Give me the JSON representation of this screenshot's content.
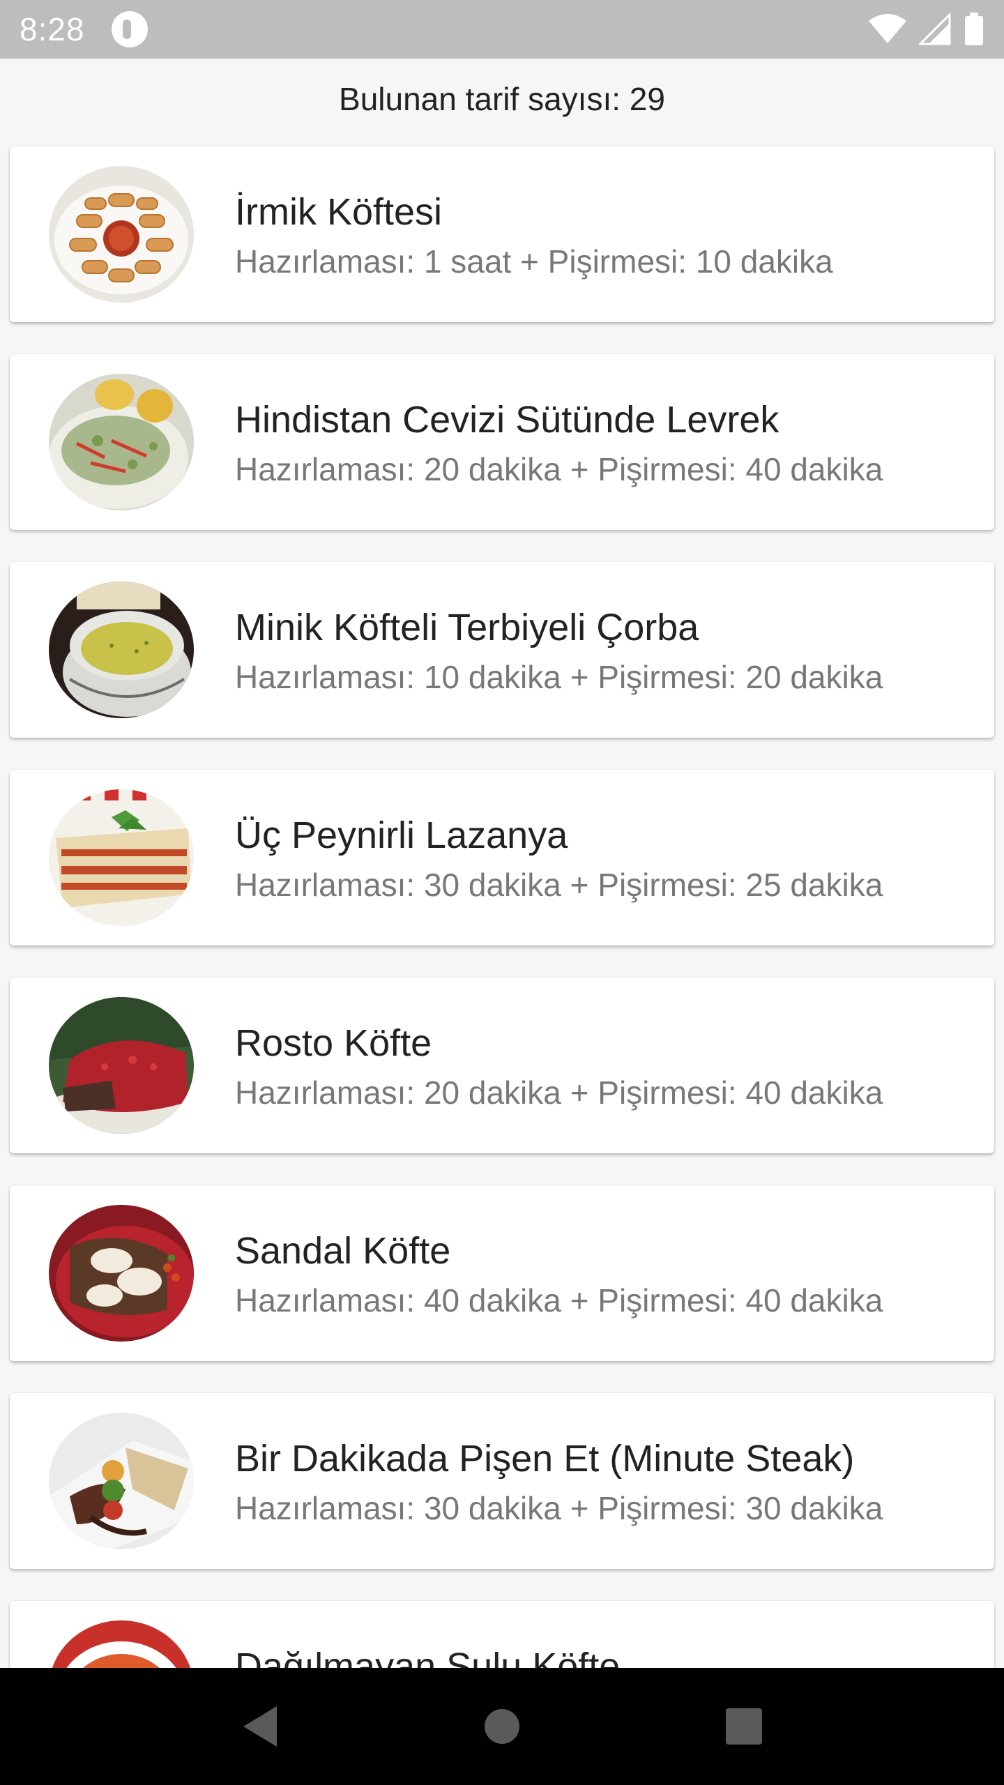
{
  "status_bar": {
    "time": "8:28",
    "icons": [
      "app-notification-icon",
      "wifi-icon",
      "signal-icon",
      "battery-icon"
    ]
  },
  "header": {
    "result_count": "Bulunan tarif sayısı: 29"
  },
  "recipes": [
    {
      "title": "İrmik Köftesi",
      "meta": "Hazırlaması: 1 saat + Pişirmesi: 10 dakika"
    },
    {
      "title": "Hindistan Cevizi Sütünde Levrek",
      "meta": "Hazırlaması: 20 dakika + Pişirmesi: 40 dakika"
    },
    {
      "title": "Minik Köfteli Terbiyeli Çorba",
      "meta": "Hazırlaması: 10 dakika + Pişirmesi: 20 dakika"
    },
    {
      "title": "Üç Peynirli Lazanya",
      "meta": "Hazırlaması: 30 dakika + Pişirmesi: 25 dakika"
    },
    {
      "title": "Rosto Köfte",
      "meta": "Hazırlaması: 20 dakika + Pişirmesi: 40 dakika"
    },
    {
      "title": "Sandal Köfte",
      "meta": "Hazırlaması: 40 dakika + Pişirmesi: 40 dakika"
    },
    {
      "title": "Bir Dakikada Pişen Et (Minute Steak)",
      "meta": "Hazırlaması: 30 dakika + Pişirmesi: 30 dakika"
    },
    {
      "title": "Dağılmayan Sulu Köfte",
      "meta": ""
    }
  ],
  "nav_bar": {
    "icons": [
      "back-icon",
      "home-icon",
      "recents-icon"
    ]
  },
  "colors": {
    "status_bar": "#bdbdbd",
    "background": "#f6f6f6",
    "card": "#ffffff",
    "title_text": "#222222",
    "meta_text": "#787878",
    "nav_bar": "#000000"
  }
}
